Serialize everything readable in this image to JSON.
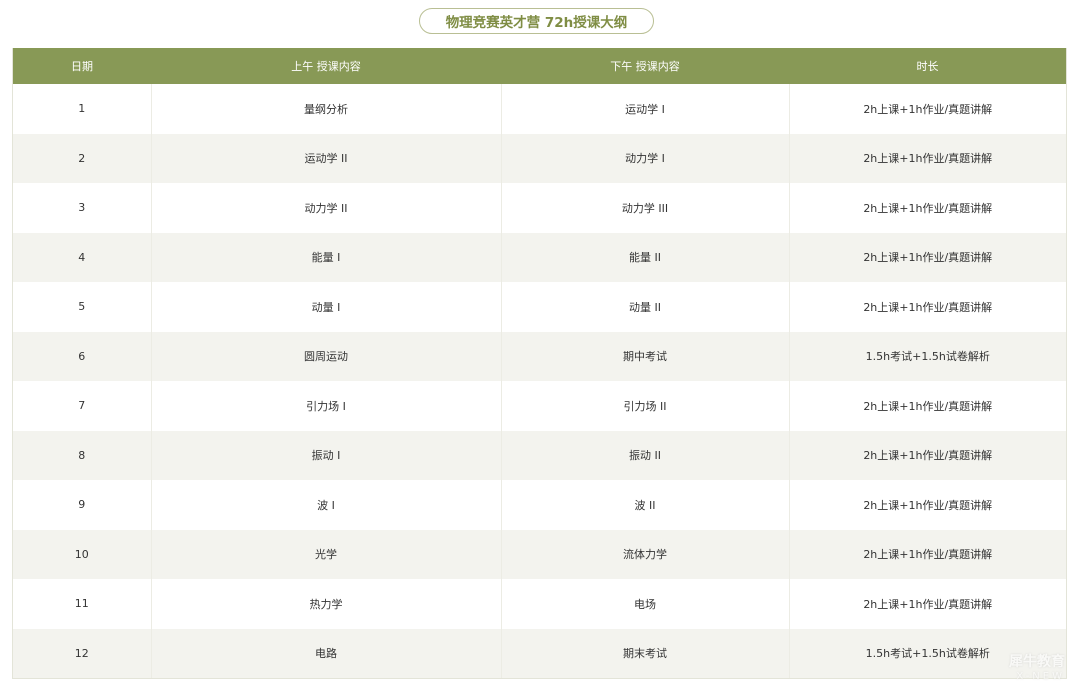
{
  "title": "物理竞赛英才营 72h授课大纲",
  "table": {
    "headers": [
      "日期",
      "上午 授课内容",
      "下午 授课内容",
      "时长"
    ],
    "rows": [
      [
        "1",
        "量纲分析",
        "运动学 I",
        "2h上课+1h作业/真题讲解"
      ],
      [
        "2",
        "运动学 II",
        "动力学 I",
        "2h上课+1h作业/真题讲解"
      ],
      [
        "3",
        "动力学 II",
        "动力学 III",
        "2h上课+1h作业/真题讲解"
      ],
      [
        "4",
        "能量 I",
        "能量 II",
        "2h上课+1h作业/真题讲解"
      ],
      [
        "5",
        "动量 I",
        "动量 II",
        "2h上课+1h作业/真题讲解"
      ],
      [
        "6",
        "圆周运动",
        "期中考试",
        "1.5h考试+1.5h试卷解析"
      ],
      [
        "7",
        "引力场 I",
        "引力场 II",
        "2h上课+1h作业/真题讲解"
      ],
      [
        "8",
        "振动 I",
        "振动 II",
        "2h上课+1h作业/真题讲解"
      ],
      [
        "9",
        "波 I",
        "波 II",
        "2h上课+1h作业/真题讲解"
      ],
      [
        "10",
        "光学",
        "流体力学",
        "2h上课+1h作业/真题讲解"
      ],
      [
        "11",
        "热力学",
        "电场",
        "2h上课+1h作业/真题讲解"
      ],
      [
        "12",
        "电路",
        "期末考试",
        "1.5h考试+1.5h试卷解析"
      ]
    ]
  },
  "watermark": {
    "text": "犀牛教育",
    "sub": "X-NEW"
  },
  "colors": {
    "accent": "#889956",
    "title_text": "#7f8d44",
    "row_alt": "#f3f3ee"
  }
}
